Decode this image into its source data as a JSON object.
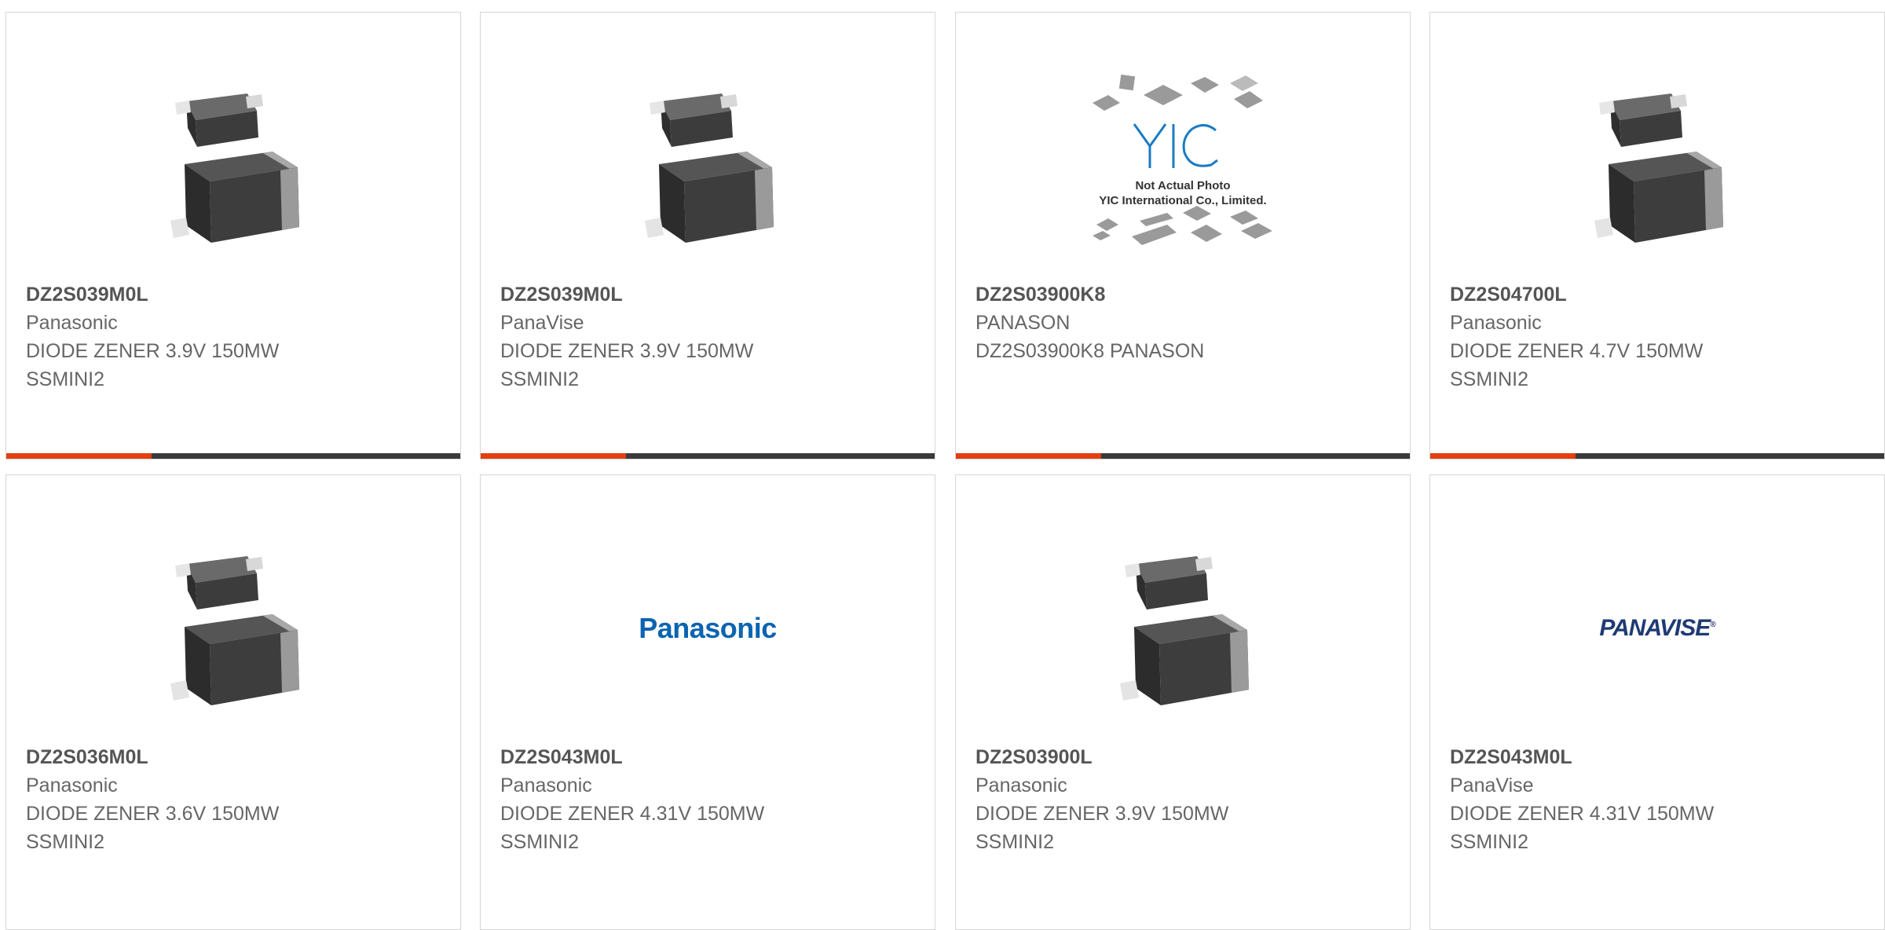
{
  "colors": {
    "accent": "#e33e11",
    "bar_base": "#3a3a3a",
    "panasonic_blue": "#0b64b1",
    "panavise_navy": "#1f3a74"
  },
  "cards": [
    {
      "part": "DZ2S039M0L",
      "manufacturer": "Panasonic",
      "line1": "DIODE ZENER 3.9V 150MW",
      "line2": "SSMINI2",
      "image": "diode-package",
      "progress": 0.32
    },
    {
      "part": "DZ2S039M0L",
      "manufacturer": "PanaVise",
      "line1": "DIODE ZENER 3.9V 150MW",
      "line2": "SSMINI2",
      "image": "diode-package",
      "progress": 0.32
    },
    {
      "part": "DZ2S03900K8",
      "manufacturer": "PANASON",
      "line1": "DZ2S03900K8 PANASON",
      "line2": "",
      "image": "yic-placeholder",
      "placeholder": {
        "logo": "YIC",
        "text1": "Not Actual Photo",
        "text2": "YIC International Co., Limited."
      },
      "progress": 0.32
    },
    {
      "part": "DZ2S04700L",
      "manufacturer": "Panasonic",
      "line1": "DIODE ZENER 4.7V 150MW",
      "line2": "SSMINI2",
      "image": "diode-package",
      "progress": 0.32
    },
    {
      "part": "DZ2S036M0L",
      "manufacturer": "Panasonic",
      "line1": "DIODE ZENER 3.6V 150MW",
      "line2": "SSMINI2",
      "image": "diode-package"
    },
    {
      "part": "DZ2S043M0L",
      "manufacturer": "Panasonic",
      "line1": "DIODE ZENER 4.31V 150MW",
      "line2": "SSMINI2",
      "image": "panasonic-logo",
      "logo_text": "Panasonic"
    },
    {
      "part": "DZ2S03900L",
      "manufacturer": "Panasonic",
      "line1": "DIODE ZENER 3.9V 150MW",
      "line2": "SSMINI2",
      "image": "diode-package"
    },
    {
      "part": "DZ2S043M0L",
      "manufacturer": "PanaVise",
      "line1": "DIODE ZENER 4.31V 150MW",
      "line2": "SSMINI2",
      "image": "panavise-logo",
      "logo_text": "PANAVISE",
      "logo_mark": "®"
    }
  ]
}
